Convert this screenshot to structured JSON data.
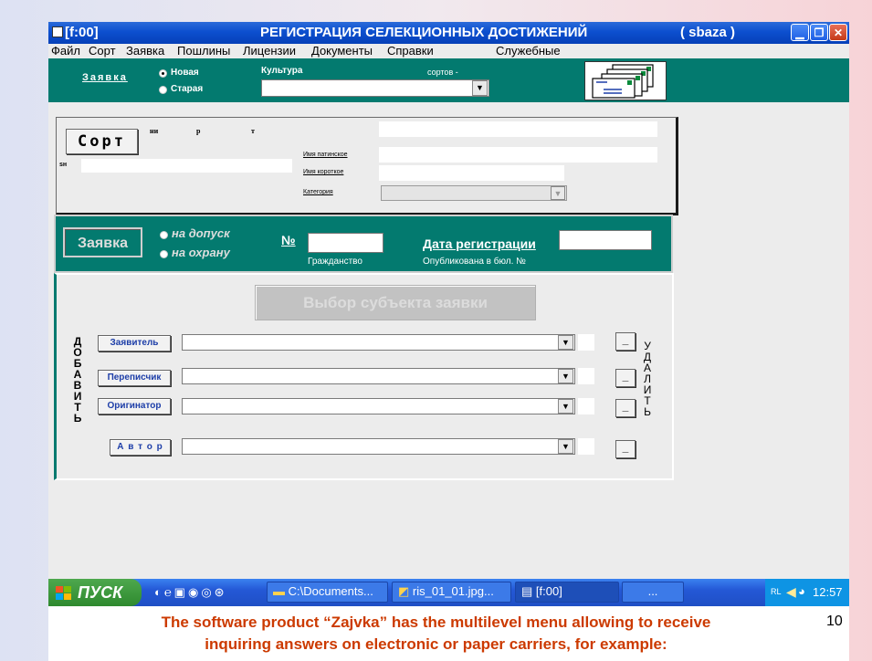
{
  "window": {
    "sys_tag": "[f:00]",
    "title": "РЕГИСТРАЦИЯ   СЕЛЕКЦИОННЫХ  ДОСТИЖЕНИЙ",
    "db_tag": "( sbaza )"
  },
  "menu": [
    "Файл",
    "Сорт",
    "Заявка",
    "Пошлины",
    "Лицензии",
    "Документы",
    "Справки",
    "Служебные"
  ],
  "top_panel": {
    "zayavka_label": "Заявка",
    "radio_new": "Новая",
    "radio_old": "Старая",
    "culture_label": "Культура",
    "sorts_label": "сортов -",
    "culture_value": ""
  },
  "sort_panel": {
    "button": "Сорт",
    "col_ni": "ни",
    "col_r": "р",
    "col_t": "т",
    "sn_label": "sн",
    "sn_value": "",
    "name_latin_label": "Имя патинское",
    "name_short_label": "Имя короткое",
    "category_label": "Категория",
    "field_top": "",
    "name_latin_value": "",
    "name_short_value": "",
    "category_value": ""
  },
  "app_panel": {
    "button": "Заявка",
    "radio_dopusk": "на допуск",
    "radio_okhrana": "на охрану",
    "num_label": "№",
    "num_value": "",
    "citizenship_label": "Гражданство",
    "date_label": "Дата регистрации",
    "date_value": "",
    "published_label": "Опубликована в бюл.  №"
  },
  "subject_panel": {
    "select_button": "Выбор   субъекта  заявки",
    "add_vertical": "ДОБАВИТЬ",
    "remove_vertical": "УДАЛИТЬ",
    "rows": [
      {
        "label": "Заявитель",
        "value": ""
      },
      {
        "label": "Переписчик",
        "value": ""
      },
      {
        "label": "Оригинатор",
        "value": ""
      },
      {
        "label": "А в т о р",
        "value": ""
      }
    ],
    "remove_label": "_"
  },
  "taskbar": {
    "start": "пуск",
    "tasks": [
      "C:\\Documents...",
      "ris_01_01.jpg...",
      "[f:00]",
      "..."
    ],
    "lang": "RL",
    "clock": "12:57"
  },
  "slide": {
    "caption_line1": "The software product “Zajvka” has the multilevel menu allowing to receive",
    "caption_line2": "inquiring answers on electronic or paper carriers, for example:",
    "page_number": "10"
  }
}
